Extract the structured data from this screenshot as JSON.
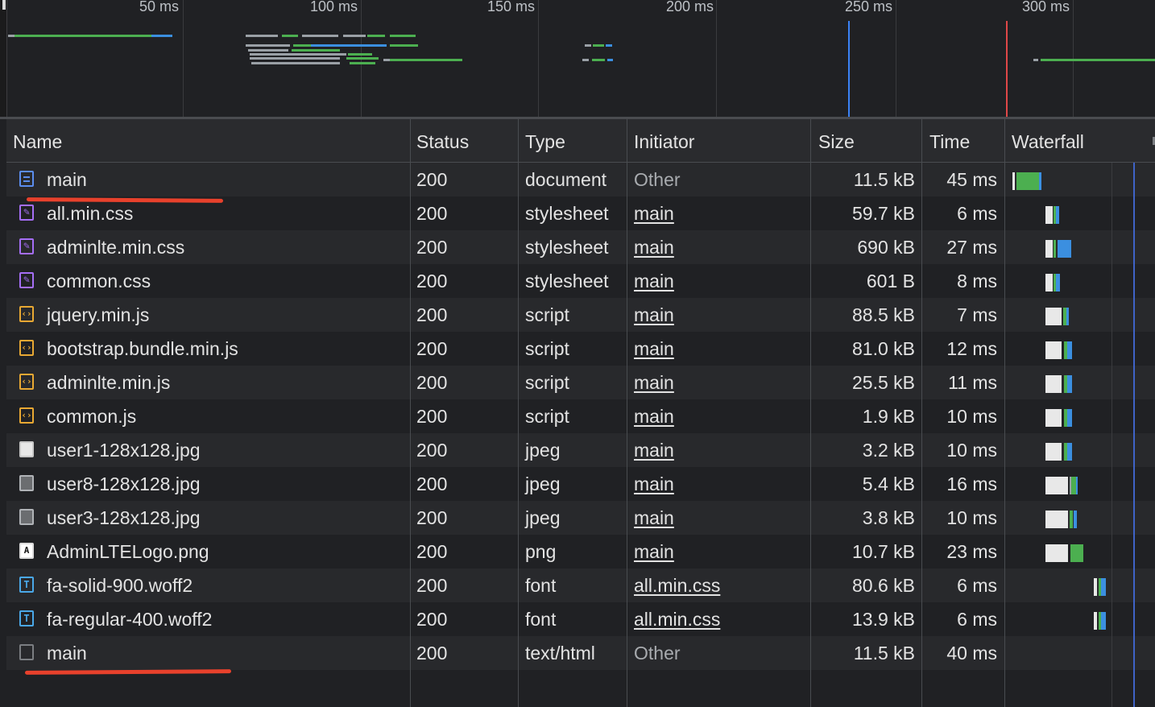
{
  "overview": {
    "tick_labels": [
      "50 ms",
      "100 ms",
      "150 ms",
      "200 ms",
      "250 ms",
      "300 ms"
    ]
  },
  "table": {
    "columns": [
      "Name",
      "Status",
      "Type",
      "Initiator",
      "Size",
      "Time",
      "Waterfall"
    ],
    "rows": [
      {
        "name": "main",
        "status": "200",
        "type": "document",
        "initiator": "Other",
        "size": "11.5 kB",
        "time": "45 ms",
        "icon": "document-icon"
      },
      {
        "name": "all.min.css",
        "status": "200",
        "type": "stylesheet",
        "initiator": "main",
        "size": "59.7 kB",
        "time": "6 ms",
        "icon": "stylesheet-icon"
      },
      {
        "name": "adminlte.min.css",
        "status": "200",
        "type": "stylesheet",
        "initiator": "main",
        "size": "690 kB",
        "time": "27 ms",
        "icon": "stylesheet-icon"
      },
      {
        "name": "common.css",
        "status": "200",
        "type": "stylesheet",
        "initiator": "main",
        "size": "601 B",
        "time": "8 ms",
        "icon": "stylesheet-icon"
      },
      {
        "name": "jquery.min.js",
        "status": "200",
        "type": "script",
        "initiator": "main",
        "size": "88.5 kB",
        "time": "7 ms",
        "icon": "script-icon"
      },
      {
        "name": "bootstrap.bundle.min.js",
        "status": "200",
        "type": "script",
        "initiator": "main",
        "size": "81.0 kB",
        "time": "12 ms",
        "icon": "script-icon"
      },
      {
        "name": "adminlte.min.js",
        "status": "200",
        "type": "script",
        "initiator": "main",
        "size": "25.5 kB",
        "time": "11 ms",
        "icon": "script-icon"
      },
      {
        "name": "common.js",
        "status": "200",
        "type": "script",
        "initiator": "main",
        "size": "1.9 kB",
        "time": "10 ms",
        "icon": "script-icon"
      },
      {
        "name": "user1-128x128.jpg",
        "status": "200",
        "type": "jpeg",
        "initiator": "main",
        "size": "3.2 kB",
        "time": "10 ms",
        "icon": "image-thumbnail-icon"
      },
      {
        "name": "user8-128x128.jpg",
        "status": "200",
        "type": "jpeg",
        "initiator": "main",
        "size": "5.4 kB",
        "time": "16 ms",
        "icon": "image-thumbnail-icon"
      },
      {
        "name": "user3-128x128.jpg",
        "status": "200",
        "type": "jpeg",
        "initiator": "main",
        "size": "3.8 kB",
        "time": "10 ms",
        "icon": "image-thumbnail-icon"
      },
      {
        "name": "AdminLTELogo.png",
        "status": "200",
        "type": "png",
        "initiator": "main",
        "size": "10.7 kB",
        "time": "23 ms",
        "icon": "png-image-icon"
      },
      {
        "name": "fa-solid-900.woff2",
        "status": "200",
        "type": "font",
        "initiator": "all.min.css",
        "size": "80.6 kB",
        "time": "6 ms",
        "icon": "font-icon"
      },
      {
        "name": "fa-regular-400.woff2",
        "status": "200",
        "type": "font",
        "initiator": "all.min.css",
        "size": "13.9 kB",
        "time": "6 ms",
        "icon": "font-icon"
      },
      {
        "name": "main",
        "status": "200",
        "type": "text/html",
        "initiator": "Other",
        "size": "11.5 kB",
        "time": "40 ms",
        "icon": "blank-file-icon"
      }
    ]
  },
  "colors": {
    "background": "#202124",
    "waiting": "#e8e8e8",
    "download_green": "#4caf50",
    "content_blue": "#3b8fe0",
    "dom_content_loaded_line": "#3b82f6",
    "load_line": "#e04848",
    "annotation_red": "#e8412c"
  }
}
